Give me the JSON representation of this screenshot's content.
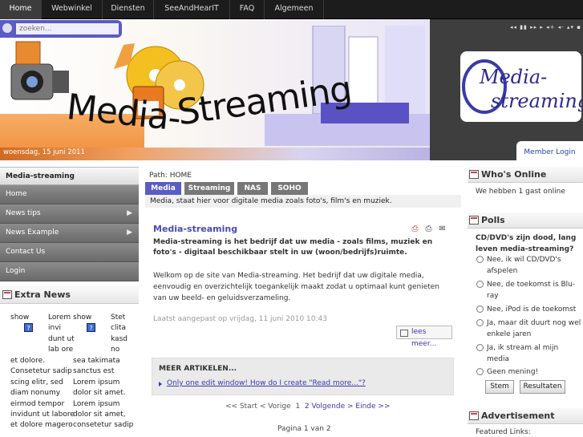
{
  "topnav": {
    "items": [
      {
        "label": "Home"
      },
      {
        "label": "Webwinkel"
      },
      {
        "label": "Diensten"
      },
      {
        "label": "SeeAndHearIT"
      },
      {
        "label": "FAQ"
      },
      {
        "label": "Algemeen"
      }
    ]
  },
  "search": {
    "placeholder": "zoeken..."
  },
  "banner": {
    "date": "woensdag, 15 juni 2011",
    "title_part1": "Media-",
    "title_part2": "Streaming",
    "logo_line1": "Media-",
    "logo_line2": "streaming",
    "member_login": "Member Login",
    "controls": "◂◂ ▮▮ ▸▸ ▸ ◂+ ◂- ▴▾ ▪"
  },
  "sidebar": {
    "header": "Media-streaming",
    "items": [
      {
        "label": "Home",
        "arrow": ""
      },
      {
        "label": "News tips",
        "arrow": "▶"
      },
      {
        "label": "News Example",
        "arrow": "▶"
      },
      {
        "label": "Contact Us",
        "arrow": ""
      },
      {
        "label": "Login",
        "arrow": ""
      }
    ]
  },
  "extra_news": {
    "title": "Extra News",
    "col1a": [
      "show",
      "?"
    ],
    "col1b": [
      "Lorem",
      "invi",
      "dunt ut",
      "lab ore"
    ],
    "col1c": [
      "et dolore.",
      "Consetetur sadip",
      "scing elitr, sed",
      "diam nonumy",
      "eirmod tempor",
      "invidunt ut labore",
      "et dolore magero"
    ],
    "col2a": [
      "show",
      "?"
    ],
    "col2b": [
      "Stet",
      "clita",
      "kasd",
      "no"
    ],
    "col2c": [
      "sea takimata",
      "sanctus est",
      "Lorem ipsum",
      "dolor sit amet.",
      "Lorem ipsum",
      "dolor sit amet,",
      "consetetur sadip"
    ]
  },
  "path": {
    "label": "Path:",
    "value": "HOME"
  },
  "tabs": [
    {
      "label": "Media"
    },
    {
      "label": "Streaming"
    },
    {
      "label": "NAS"
    },
    {
      "label": "SOHO"
    }
  ],
  "tagline": "Media, staat hier voor digitale media zoals foto's, film's en muziek.",
  "article": {
    "title": "Media-streaming",
    "intro": "Media-streaming is het bedrijf dat uw media - zoals films, muziek en foto's - digitaal beschikbaar stelt in uw (woon/bedrijfs)ruimte.",
    "body": "Welkom op de site van Media-streaming. Het bedrijf dat uw digitale media, eenvoudig en overzichtelijk toegankelijk maakt zodat u optimaal kunt genieten van uw beeld- en geluidsverzameling.",
    "modified": "Laatst aangepast op vrijdag, 11 juni 2010 10:43",
    "readmore": "lees meer..."
  },
  "more_articles": {
    "header": "MEER ARTIKELEN...",
    "link": "Only one edit window! How do I create \"Read more...\"?"
  },
  "pagination": {
    "start": "<< Start",
    "prev": "< Vorige",
    "p1": "1",
    "p2": "2",
    "next": "Volgende >",
    "end": "Einde >>",
    "count": "Pagina 1 van 2"
  },
  "whos_online": {
    "title": "Who's Online",
    "text": "We hebben 1 gast online"
  },
  "polls": {
    "title": "Polls",
    "question": "CD/DVD's zijn dood, lang leven media-streaming?",
    "options": [
      "Nee, ik wil CD/DVD's afspelen",
      "Nee, de toekomst is Blu-ray",
      "Nee, iPod is de toekomst",
      "Ja, maar dit duurt nog wel enkele jaren",
      "Ja, ik stream al mijn media",
      "Geen mening!"
    ],
    "vote": "Stem",
    "results": "Resultaten"
  },
  "advertisement": {
    "title": "Advertisement",
    "featured": "Featured Links:"
  }
}
